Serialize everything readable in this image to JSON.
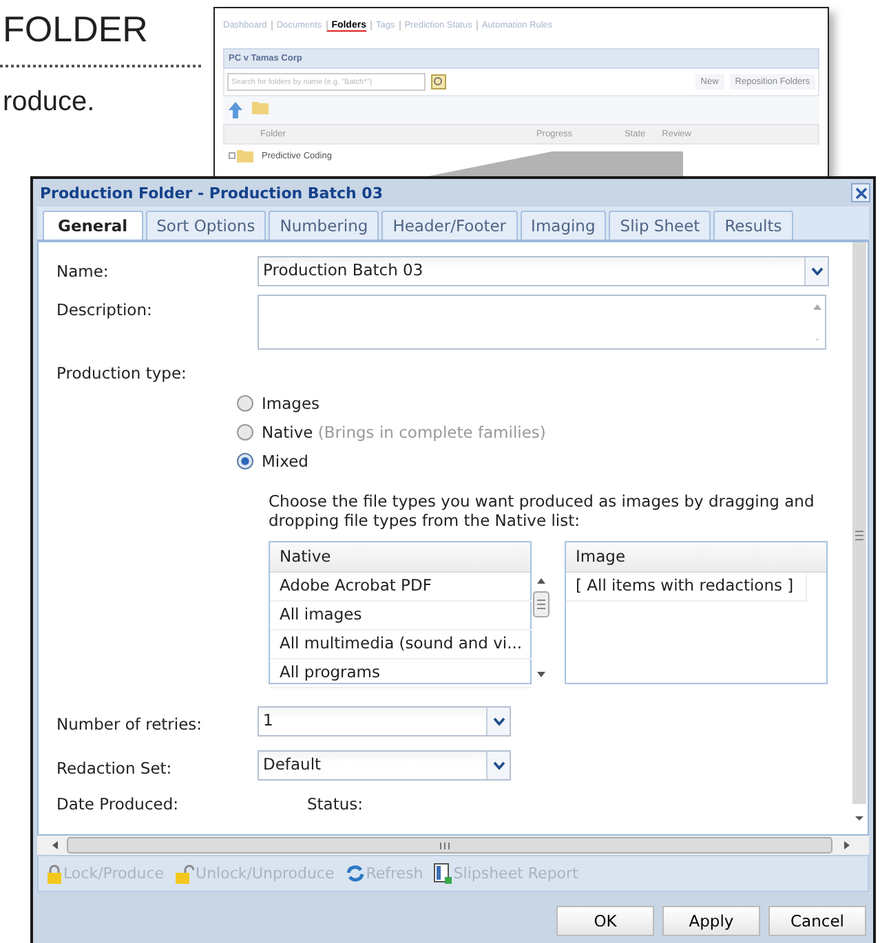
{
  "doc": {
    "heading": "FOLDER",
    "text": "roduce."
  },
  "background_app": {
    "nav": [
      {
        "label": "Dashboard",
        "selected": false
      },
      {
        "label": "Documents",
        "selected": false
      },
      {
        "label": "Folders",
        "selected": true
      },
      {
        "label": "Tags",
        "selected": false
      },
      {
        "label": "Prediction Status",
        "selected": false
      },
      {
        "label": "Automation Rules",
        "selected": false
      }
    ],
    "panel_title": "PC v Tamas Corp",
    "search": {
      "placeholder": "Search for folders by name (e.g. \"Batch*\")"
    },
    "buttons": [
      "New",
      "Reposition Folders"
    ],
    "columns": [
      "Folder",
      "Progress",
      "State",
      "Review"
    ],
    "rows": [
      {
        "name": "Predictive Coding"
      }
    ]
  },
  "dialog": {
    "title": "Production Folder - Production Batch 03",
    "tabs": [
      {
        "label": "General",
        "selected": true
      },
      {
        "label": "Sort Options",
        "selected": false
      },
      {
        "label": "Numbering",
        "selected": false
      },
      {
        "label": "Header/Footer",
        "selected": false
      },
      {
        "label": "Imaging",
        "selected": false
      },
      {
        "label": "Slip Sheet",
        "selected": false
      },
      {
        "label": "Results",
        "selected": false
      }
    ],
    "name": {
      "label": "Name:",
      "value": "Production Batch 03"
    },
    "description": {
      "label": "Description:"
    },
    "production_type": {
      "label": "Production type:",
      "options": [
        {
          "label": "Images",
          "selected": false
        },
        {
          "label": "Native",
          "hint": "(Brings in complete families)",
          "selected": false
        },
        {
          "label": "Mixed",
          "selected": true
        }
      ]
    },
    "instructions": "Choose the file types you want produced as images by dragging and dropping file types from the Native list:",
    "native_list": {
      "heading": "Native",
      "items": [
        "Adobe Acrobat PDF",
        "All images",
        "All multimedia (sound and vi...",
        "All programs"
      ]
    },
    "image_list": {
      "heading": "Image",
      "items": [
        "[ All items with redactions ]"
      ]
    },
    "retries": {
      "label": "Number of retries:",
      "value": "1"
    },
    "redaction_set": {
      "label": "Redaction Set:",
      "value": "Default"
    },
    "date_produced": {
      "label": "Date Produced:"
    },
    "status": {
      "label": "Status:"
    },
    "actions": [
      {
        "kind": "lock",
        "label": "Lock/Produce",
        "disabled": true
      },
      {
        "kind": "unlock",
        "label": "Unlock/Unproduce",
        "disabled": true
      },
      {
        "kind": "refresh",
        "label": "Refresh",
        "disabled": true
      },
      {
        "kind": "report",
        "label": "Slipsheet Report",
        "disabled": true
      }
    ],
    "buttons": [
      "OK",
      "Apply",
      "Cancel"
    ]
  }
}
